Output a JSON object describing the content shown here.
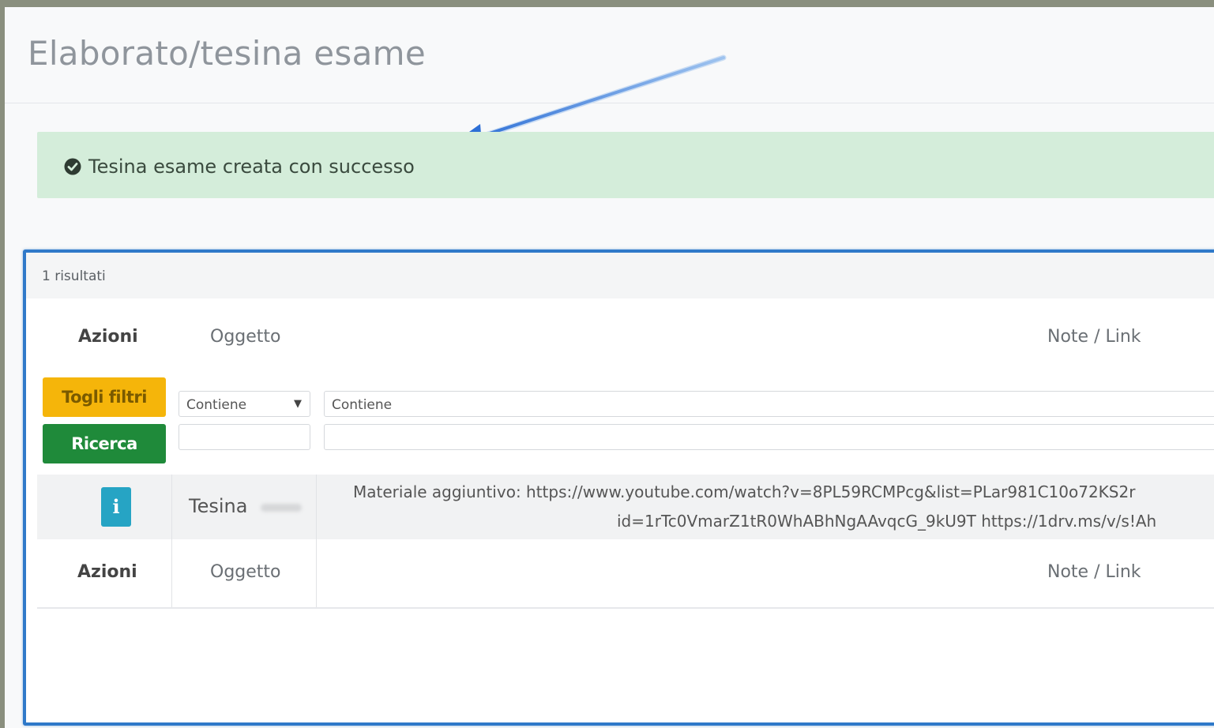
{
  "page": {
    "title": "Elaborato/tesina esame"
  },
  "alert": {
    "icon": "check-circle-icon",
    "message": "Tesina esame creata con successo",
    "color": "#d4edda"
  },
  "results": {
    "count_label": "1 risultati"
  },
  "table": {
    "headers": {
      "azioni": "Azioni",
      "oggetto": "Oggetto",
      "note": "Note / Link"
    },
    "filters": {
      "clear_label": "Togli filtri",
      "search_label": "Ricerca",
      "oggetto_mode": "Contiene",
      "note_mode": "Contiene"
    },
    "rows": [
      {
        "action_icon": "info-icon",
        "action_label": "i",
        "oggetto": "Tesina",
        "note_line1": "Materiale aggiuntivo: https://www.youtube.com/watch?v=8PL59RCMPcg&list=PLar981C10o72KS2r",
        "note_line2": "id=1rTc0VmarZ1tR0WhABhNgAAvqcG_9kU9T https://1drv.ms/v/s!Ah"
      }
    ],
    "footer": {
      "azioni": "Azioni",
      "oggetto": "Oggetto",
      "note": "Note / Link"
    }
  },
  "colors": {
    "warning": "#f5b50a",
    "success": "#1f8a3a",
    "info": "#26a4c4",
    "panel_border": "#2f79c9"
  }
}
